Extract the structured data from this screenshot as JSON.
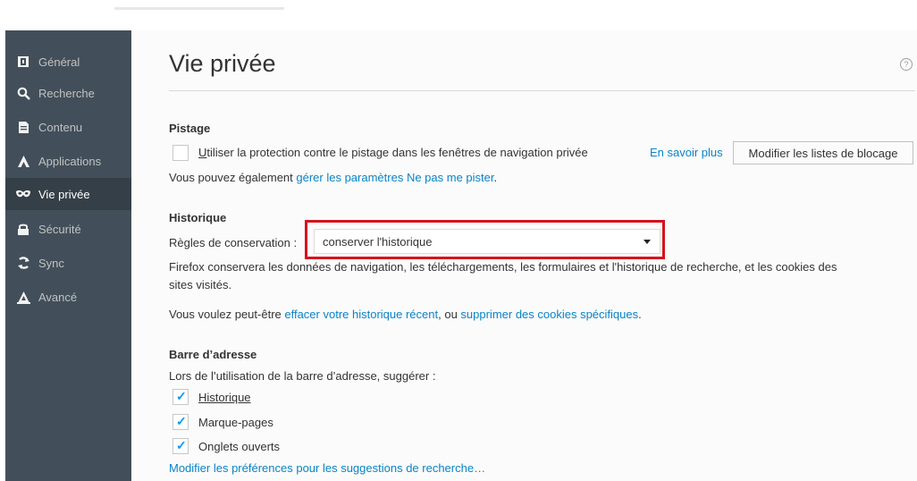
{
  "sidebar": {
    "items": [
      {
        "label": "Général",
        "icon": "general-icon"
      },
      {
        "label": "Recherche",
        "icon": "search-icon"
      },
      {
        "label": "Contenu",
        "icon": "content-icon"
      },
      {
        "label": "Applications",
        "icon": "applications-icon"
      },
      {
        "label": "Vie privée",
        "icon": "privacy-mask-icon",
        "active": true
      },
      {
        "label": "Sécurité",
        "icon": "lock-icon"
      },
      {
        "label": "Sync",
        "icon": "sync-icon"
      },
      {
        "label": "Avancé",
        "icon": "advanced-icon"
      }
    ]
  },
  "page": {
    "title": "Vie privée",
    "help_label": "?"
  },
  "tracking": {
    "heading": "Pistage",
    "checkbox_label_pre": "U",
    "checkbox_label_post": "tiliser la protection contre le pistage dans les fenêtres de navigation privée",
    "checked": false,
    "learn_more": "En savoir plus",
    "block_lists_button": "Modifier les listes de blocage",
    "dnt_text": "Vous pouvez également ",
    "dnt_link": "gérer les paramètres Ne pas me pister",
    "dnt_end": "."
  },
  "history": {
    "heading": "Historique",
    "rules_label": "Règles de conservation :",
    "rules_value": "conserver l'historique",
    "description_line1": "Firefox conservera les données de navigation, les téléchargements, les formulaires et l'historique de recherche, et les cookies des",
    "description_line2": "sites visités.",
    "suggest_pre": "Vous voulez peut-être ",
    "clear_link": "effacer votre historique récent",
    "suggest_mid": ", ou ",
    "cookies_link": "supprimer des cookies spécifiques",
    "suggest_end": "."
  },
  "address_bar": {
    "heading": "Barre d’adresse",
    "intro": "Lors de l’utilisation de la barre d’adresse, suggérer :",
    "options": [
      {
        "label": "Historique",
        "checked": true
      },
      {
        "label": "Marque-pages",
        "checked": true
      },
      {
        "label": "Onglets ouverts",
        "checked": true
      }
    ],
    "prefs_link": "Modifier les préférences pour les suggestions de recherche…"
  },
  "colors": {
    "sidebar_bg": "#424f5a",
    "sidebar_active": "#343f48",
    "link": "#0a84c6",
    "highlight": "#d6131c",
    "check": "#0996f8"
  }
}
